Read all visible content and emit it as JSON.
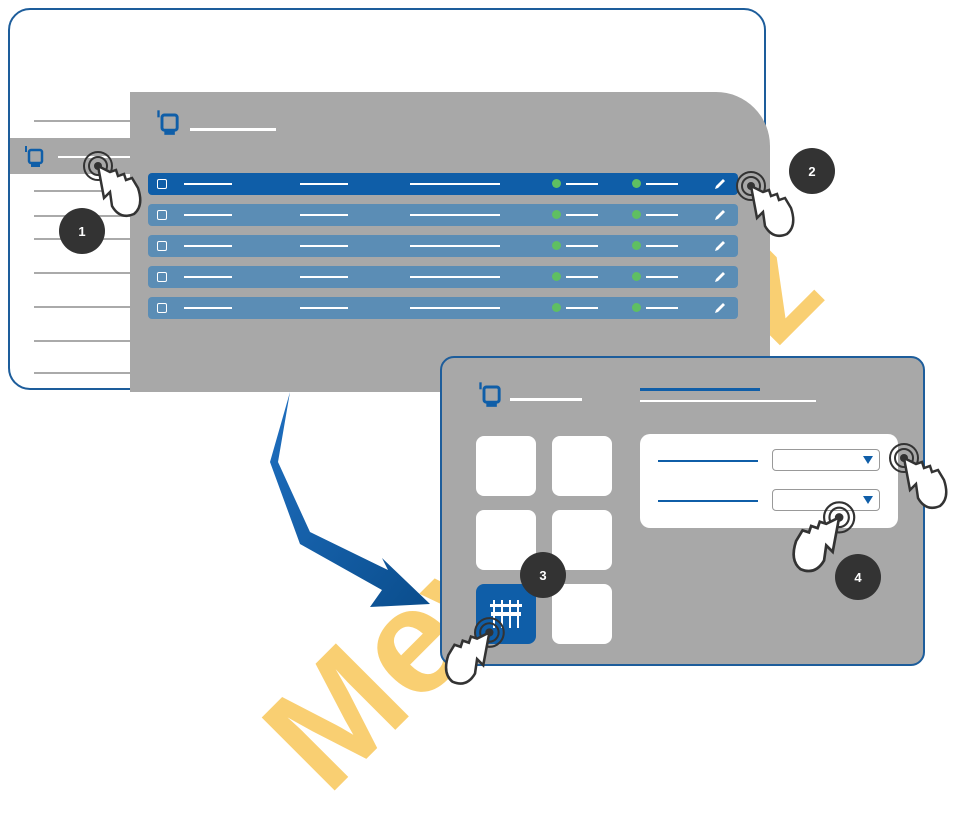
{
  "badges": {
    "b1": "1",
    "b2": "2",
    "b3": "3",
    "b4": "4"
  },
  "watermark": "Mevata.cz",
  "colors": {
    "accent": "#0f5ea8",
    "row": "#5b8db5",
    "frame": "#1d5d9b",
    "grey": "#a8a8a8",
    "status": "#5fbf62",
    "watermark": "#f5a800"
  },
  "icons": [
    "device-icon",
    "edit-pencil-icon",
    "hand-tap-icon",
    "dropdown-arrow-icon",
    "mixer-icon",
    "arrow-icon"
  ]
}
